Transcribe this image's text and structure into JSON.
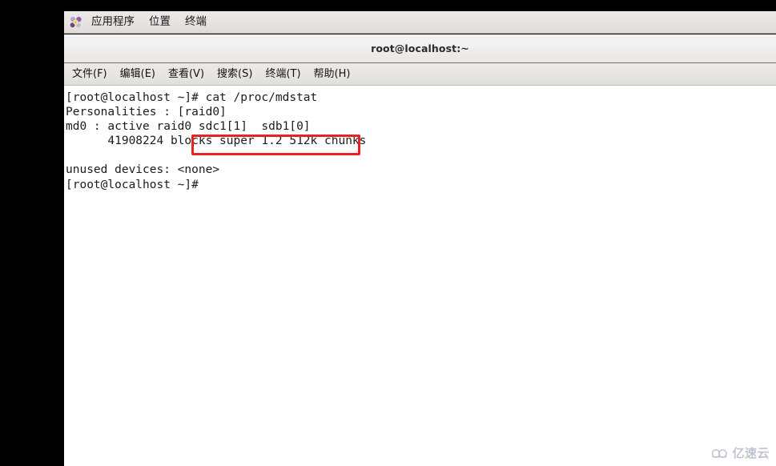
{
  "desktop": {
    "panel": {
      "icon_name": "gnome-applications-icon",
      "items": [
        {
          "label": "应用程序"
        },
        {
          "label": "位置"
        },
        {
          "label": "终端"
        }
      ]
    }
  },
  "window": {
    "title": "root@localhost:~",
    "menubar": [
      {
        "label": "文件(F)"
      },
      {
        "label": "编辑(E)"
      },
      {
        "label": "查看(V)"
      },
      {
        "label": "搜索(S)"
      },
      {
        "label": "终端(T)"
      },
      {
        "label": "帮助(H)"
      }
    ],
    "terminal": {
      "content": "[root@localhost ~]# cat /proc/mdstat\nPersonalities : [raid0]\nmd0 : active raid0 sdc1[1]  sdb1[0]\n      41908224 blocks super 1.2 512k chunks\n\nunused devices: <none>\n[root@localhost ~]# ",
      "lines": [
        "[root@localhost ~]# cat /proc/mdstat",
        "Personalities : [raid0]",
        "md0 : active raid0 sdc1[1]  sdb1[0]",
        "      41908224 blocks super 1.2 512k chunks",
        "",
        "unused devices: <none>",
        "[root@localhost ~]# "
      ]
    }
  },
  "annotation": {
    "name": "highlight-rectangle",
    "color": "#e8221c",
    "targets_text": "# cat /proc/mdstat"
  },
  "watermark": {
    "text": "亿速云",
    "icon_name": "cloud-icon",
    "color": "#9aa0b4"
  },
  "colors": {
    "panel_bg": "#e8e6e3",
    "titlebar_bg": "#f1f0ef",
    "menubar_bg": "#e7e5e2",
    "terminal_bg": "#ffffff",
    "terminal_fg": "#1c1c1c",
    "backdrop": "#000000",
    "annotation_red": "#e8221c"
  }
}
